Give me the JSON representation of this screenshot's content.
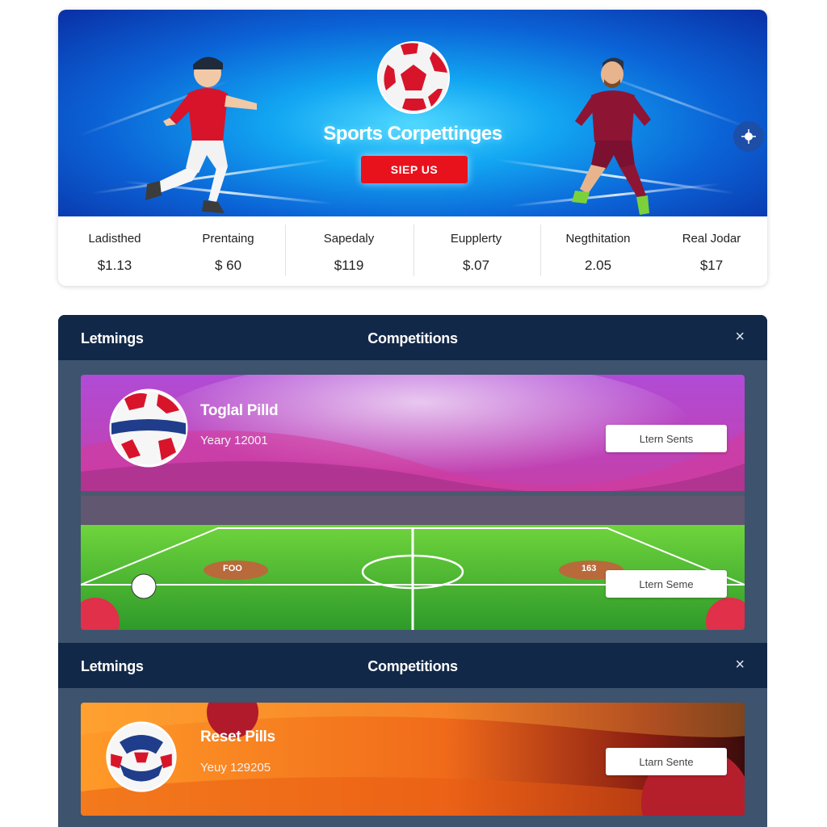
{
  "hero": {
    "title": "Sports Corpettinges",
    "cta_label": "SIEP US"
  },
  "stats": [
    {
      "label": "Ladisthed",
      "value": "$1.13"
    },
    {
      "label": "Prentaing",
      "value": "$ 60"
    },
    {
      "label": "Sapedaly",
      "value": "$119"
    },
    {
      "label": "Eupplerty",
      "value": "$.07"
    },
    {
      "label": "Negthitation",
      "value": "2.05"
    },
    {
      "label": "Real Jodar",
      "value": "$17"
    }
  ],
  "panels": [
    {
      "left_label": "Letmings",
      "center_label": "Competitions",
      "close_glyph": "×",
      "card": {
        "title": "Toglal Pilld",
        "subtitle": "Yeary 12001",
        "button_1": "Ltern Sents",
        "button_2": "Ltern Seme",
        "field_left_mark": "FOO",
        "field_right_mark": "163"
      }
    },
    {
      "left_label": "Letmings",
      "center_label": "Competitions",
      "close_glyph": "×",
      "card": {
        "title": "Reset Pills",
        "subtitle": "Yeuy 129205",
        "button_1": "Ltarn Sente"
      }
    }
  ],
  "colors": {
    "brand_red": "#e8121c",
    "header_navy": "#122848",
    "panel_slate": "#3d536e",
    "hero_blue": "#12a6f2"
  },
  "icons": [
    "soccer-ball-icon",
    "sparkle-icon",
    "close-icon"
  ]
}
